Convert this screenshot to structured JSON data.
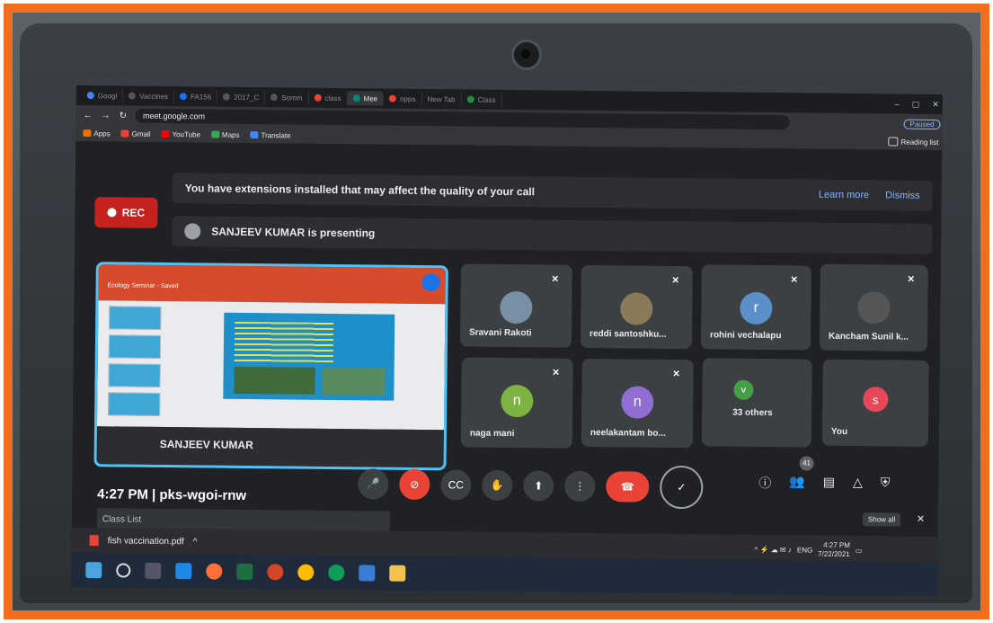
{
  "browser": {
    "tabs": [
      "Googl",
      "Vaccines",
      "FA156",
      "2017_C",
      "Somm",
      "class",
      "Mee",
      "npps",
      "New Tab",
      "Class"
    ],
    "active_tab_index": 6,
    "url": "meet.google.com",
    "profile_label": "Paused",
    "bookmarks": [
      "Apps",
      "Gmail",
      "YouTube",
      "Maps",
      "Translate"
    ],
    "reading_list": "Reading list"
  },
  "meet": {
    "rec_label": "REC",
    "extension_notice": "You have extensions installed that may affect the quality of your call",
    "learn_more": "Learn more",
    "dismiss": "Dismiss",
    "presenting_text": "SANJEEV KUMAR is presenting",
    "presenter_name": "SANJEEV KUMAR",
    "slide_title": "Ecology Seminar - Saved",
    "participants": [
      {
        "name": "Sravani Rakoti",
        "avatar": "photo",
        "color": "#7a8fa6"
      },
      {
        "name": "reddi santoshku...",
        "avatar": "photo",
        "color": "#8a7a5a"
      },
      {
        "name": "rohini vechalapu",
        "avatar": "r",
        "color": "#5b8fc9"
      },
      {
        "name": "Kancham Sunil k...",
        "avatar": "photo",
        "color": "#555"
      },
      {
        "name": "naga mani",
        "avatar": "n",
        "color": "#7cb342"
      },
      {
        "name": "neelakantam bo...",
        "avatar": "n",
        "color": "#8e6fd1"
      },
      {
        "name": "33 others",
        "avatar": "v",
        "color": "#43a047"
      },
      {
        "name": "You",
        "avatar": "s",
        "color": "#e8475a"
      }
    ],
    "participant_count": "41",
    "time": "4:27 PM",
    "meeting_code": "pks-wgoi-rnw"
  },
  "taskbar": {
    "class_list": "Class List",
    "download_file": "fish vaccination.pdf",
    "show_all": "Show all",
    "lang": "ENG",
    "clock_time": "4:27 PM",
    "clock_date": "7/22/2021"
  }
}
